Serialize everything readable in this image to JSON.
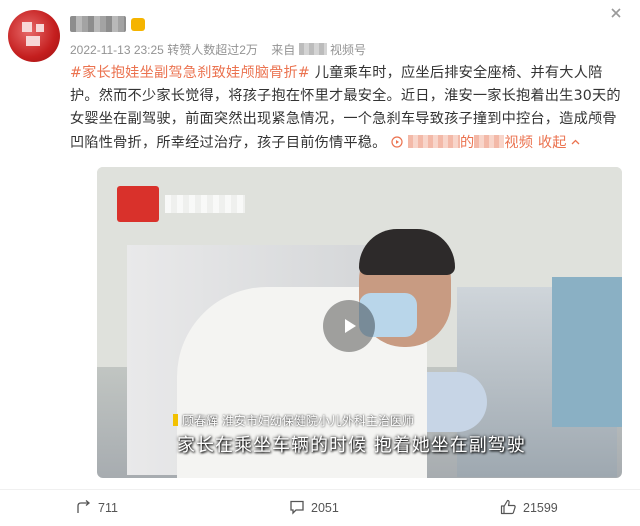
{
  "post": {
    "date": "2022-11-13 23:25",
    "reposts_info": "转赞人数超过2万",
    "source_prefix": "来自",
    "source_suffix": "视频号",
    "hashtag": "#家长抱娃坐副驾急刹致娃颅脑骨折#",
    "body_text": "儿童乘车时，应坐后排安全座椅、并有大人陪护。然而不少家长觉得，将孩子抱在怀里才最安全。近日，淮安一家长抱着出生30天的女婴坐在副驾驶，前面突然出现紧急情况，一个急刹车导致孩子撞到中控台，造成颅骨凹陷性骨折，所幸经过治疗，孩子目前伤情平稳。",
    "video_link_middle": "的",
    "video_link_suffix": "视频",
    "collapse_label": "收起"
  },
  "video": {
    "caption_name": "顾春辉 淮安市妇幼保健院小儿外科主治医师",
    "subtitle": "家长在乘坐车辆的时候 抱着她坐在副驾驶"
  },
  "actions": {
    "repost_count": "711",
    "comment_count": "2051",
    "like_count": "21599"
  },
  "icons": {
    "repost": "repost-icon",
    "comment": "comment-icon",
    "like": "like-icon",
    "close": "close-icon",
    "play": "play-icon"
  },
  "colors": {
    "accent": "#eb7350",
    "meta_text": "#939393"
  }
}
